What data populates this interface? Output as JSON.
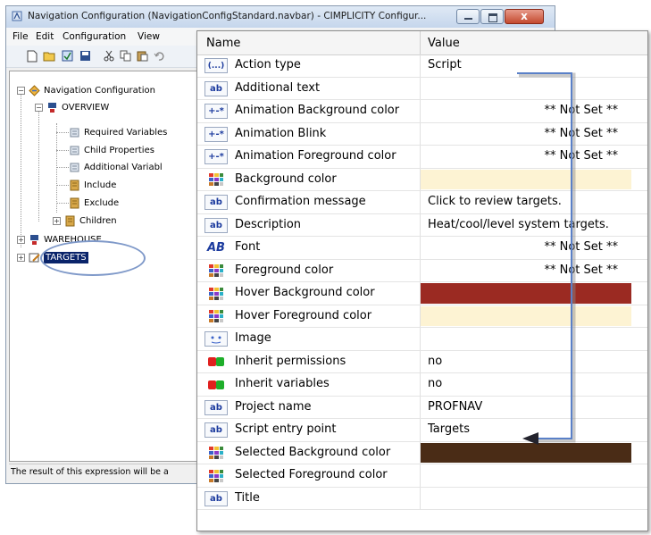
{
  "window": {
    "title": "Navigation Configuration (NavigationConfigStandard.navbar) - CIMPLICITY Configur...",
    "close_glyph": "x"
  },
  "menu": {
    "items": [
      "File",
      "Edit",
      "Configuration",
      "View"
    ]
  },
  "toolbar": {
    "icons": [
      "new-icon",
      "open-icon",
      "properties-icon",
      "save-icon",
      "cut-icon",
      "copy-icon",
      "paste-icon",
      "undo-icon"
    ]
  },
  "tree": {
    "root": "Navigation Configuration",
    "overview": "OVERVIEW",
    "required_variables": "Required Variables",
    "child_properties": "Child Properties",
    "additional_variables": "Additional Variabl",
    "include": "Include",
    "exclude": "Exclude",
    "children": "Children",
    "warehouse": "WAREHOUSE",
    "targets": "TARGETS"
  },
  "status": {
    "text": "The result of this expression will be a"
  },
  "grid": {
    "header_name": "Name",
    "header_value": "Value",
    "rows": [
      {
        "icon": "...",
        "icon_name": "ellipsis-icon",
        "name": "Action type",
        "value": "Script"
      },
      {
        "icon": "ab",
        "icon_name": "text-icon",
        "name": "Additional text",
        "value": ""
      },
      {
        "icon": "+-*",
        "icon_name": "expression-icon",
        "name": "Animation Background color",
        "value": "** Not Set **"
      },
      {
        "icon": "+-*",
        "icon_name": "expression-icon",
        "name": "Animation Blink",
        "value": "** Not Set **"
      },
      {
        "icon": "+-*",
        "icon_name": "expression-icon",
        "name": "Animation Foreground color",
        "value": "** Not Set **"
      },
      {
        "icon": "",
        "icon_name": "color-palette-icon",
        "name": "Background color",
        "value": "",
        "swatch": "#fdf3d3"
      },
      {
        "icon": "ab",
        "icon_name": "text-icon",
        "name": "Confirmation message",
        "value": "Click to review targets."
      },
      {
        "icon": "ab",
        "icon_name": "text-icon",
        "name": "Description",
        "value": "Heat/cool/level system targets."
      },
      {
        "icon": "AB",
        "icon_name": "font-icon",
        "name": "Font",
        "value": "** Not Set **"
      },
      {
        "icon": "",
        "icon_name": "color-palette-icon",
        "name": "Foreground color",
        "value": "** Not Set **"
      },
      {
        "icon": "",
        "icon_name": "color-palette-icon",
        "name": "Hover Background color",
        "value": "",
        "swatch": "#9b2a22"
      },
      {
        "icon": "",
        "icon_name": "color-palette-icon",
        "name": "Hover Foreground color",
        "value": "",
        "swatch": "#fdf3d3"
      },
      {
        "icon": "",
        "icon_name": "image-icon",
        "name": "Image",
        "value": ""
      },
      {
        "icon": "",
        "icon_name": "boolean-icon",
        "name": "Inherit permissions",
        "value": "no"
      },
      {
        "icon": "",
        "icon_name": "boolean-icon",
        "name": "Inherit variables",
        "value": "no"
      },
      {
        "icon": "ab",
        "icon_name": "text-icon",
        "name": "Project name",
        "value": "PROFNAV"
      },
      {
        "icon": "ab",
        "icon_name": "text-icon",
        "name": "Script entry point",
        "value": "Targets"
      },
      {
        "icon": "",
        "icon_name": "color-palette-icon",
        "name": "Selected Background color",
        "value": "",
        "swatch": "#4a2c16"
      },
      {
        "icon": "",
        "icon_name": "color-palette-icon",
        "name": "Selected Foreground color",
        "value": ""
      },
      {
        "icon": "ab",
        "icon_name": "text-icon",
        "name": "Title",
        "value": ""
      }
    ]
  },
  "colors": {
    "selection": "#0a246a",
    "accent_arrow": "#5a80c8"
  }
}
